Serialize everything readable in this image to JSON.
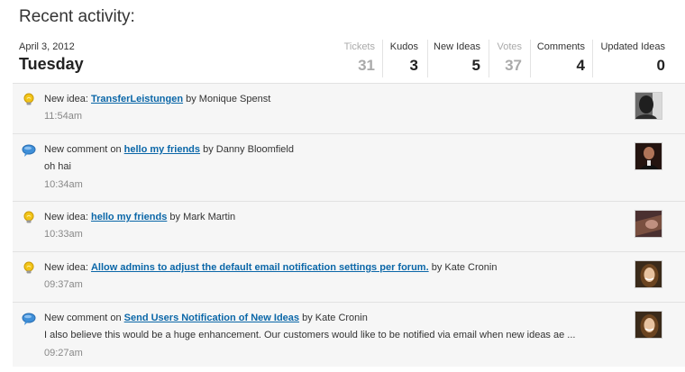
{
  "title": "Recent activity:",
  "date": {
    "full": "April 3, 2012",
    "weekday": "Tuesday"
  },
  "stats": [
    {
      "label": "Tickets",
      "value": "31",
      "muted": true
    },
    {
      "label": "Kudos",
      "value": "3",
      "muted": false
    },
    {
      "label": "New Ideas",
      "value": "5",
      "muted": false
    },
    {
      "label": "Votes",
      "value": "37",
      "muted": true
    },
    {
      "label": "Comments",
      "value": "4",
      "muted": false
    },
    {
      "label": "Updated Ideas",
      "value": "0",
      "muted": false
    }
  ],
  "feed": [
    {
      "icon": "lightbulb-icon",
      "prefix": "New idea:",
      "link": "TransferLeistungen",
      "by": "by Monique Spenst",
      "excerpt": "",
      "time": "11:54am"
    },
    {
      "icon": "speech-bubble-icon",
      "prefix": "New comment on",
      "link": "hello my friends",
      "by": "by Danny Bloomfield",
      "excerpt": "oh hai",
      "time": "10:34am"
    },
    {
      "icon": "lightbulb-icon",
      "prefix": "New idea:",
      "link": "hello my friends",
      "by": "by Mark Martin",
      "excerpt": "",
      "time": "10:33am"
    },
    {
      "icon": "lightbulb-icon",
      "prefix": "New idea:",
      "link": "Allow admins to adjust the default email notification settings per forum.",
      "by": "by Kate Cronin",
      "excerpt": "",
      "time": "09:37am"
    },
    {
      "icon": "speech-bubble-icon",
      "prefix": "New comment on",
      "link": "Send Users Notification of New Ideas",
      "by": "by Kate Cronin",
      "excerpt": "I also believe this would be a huge enhancement. Our customers would like to be notified via email when new ideas ae ...",
      "time": "09:27am"
    }
  ],
  "colors": {
    "link": "#0b67a8",
    "muted": "#aaaaaa",
    "row_bg": "#f6f6f6",
    "bulb": "#f2c418",
    "bubble": "#3f8fd8"
  }
}
